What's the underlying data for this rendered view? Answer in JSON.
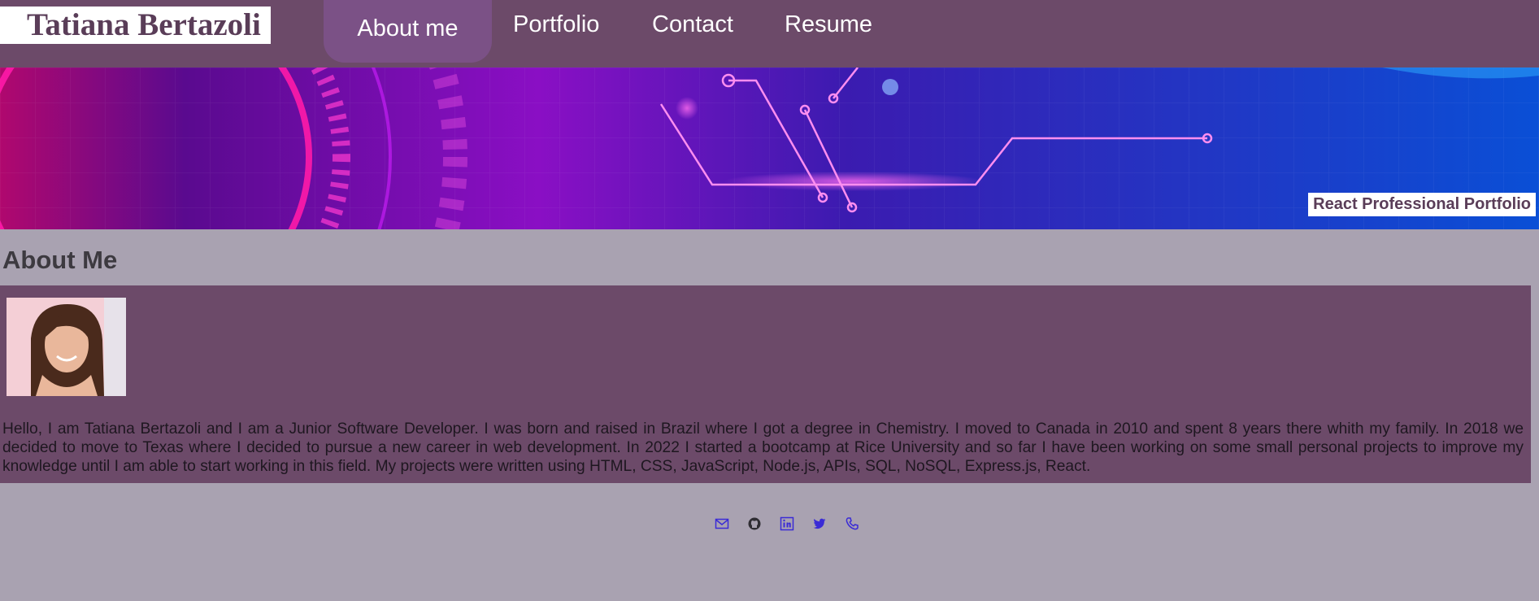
{
  "header": {
    "brand": "Tatiana Bertazoli",
    "nav": [
      {
        "label": "About me",
        "active": true
      },
      {
        "label": "Portfolio",
        "active": false
      },
      {
        "label": "Contact",
        "active": false
      },
      {
        "label": "Resume",
        "active": false
      }
    ]
  },
  "banner": {
    "label": "React Professional Portfolio"
  },
  "about": {
    "title": "About Me",
    "bio": "Hello, I am Tatiana Bertazoli and I am a Junior Software Developer. I was born and raised in Brazil where I got a degree in Chemistry. I moved to Canada in 2010 and spent 8 years there whith my family. In 2018 we decided to move to Texas where I decided to pursue a new career in web development. In 2022 I started a bootcamp at Rice University and so far I have been working on some small personal projects to improve my knowledge until I am able to start working in this field. My projects were written using HTML, CSS, JavaScript, Node.js, APIs, SQL, NoSQL, Express.js, React."
  },
  "footer": {
    "social_icons": [
      "mail-icon",
      "github-icon",
      "linkedin-icon",
      "twitter-icon",
      "phone-icon"
    ]
  },
  "colors": {
    "nav_bg": "#6c4a69",
    "nav_active": "#7b5186",
    "page_bg": "#a9a2b1",
    "icon_color": "#3a2bd6"
  }
}
